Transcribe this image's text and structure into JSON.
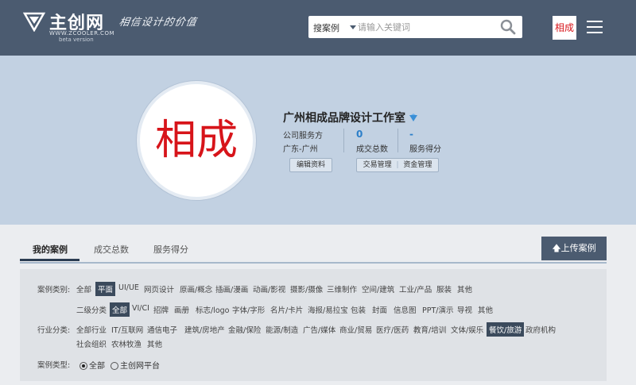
{
  "header": {
    "brand": "主创网",
    "url": "WWW.ZCOOLER.COM",
    "beta": "beta version",
    "slogan": "相信设计的价值",
    "search": {
      "type": "搜案例",
      "placeholder": "请输入关键词"
    },
    "avatar_text": "相成"
  },
  "profile": {
    "avatar_text": "相成",
    "name": "广州相成品牌设计工作室",
    "role": "公司服务方",
    "location": "广东-广州",
    "deals_value": "0",
    "deals_label": "成交总数",
    "score_value": "-",
    "score_label": "服务得分",
    "edit_label": "编辑资料",
    "trade_label": "交易管理",
    "fund_label": "资金管理"
  },
  "tabs": [
    "我的案例",
    "成交总数",
    "服务得分"
  ],
  "upload_label": "上传案例",
  "filters": {
    "category_label": "案例类别:",
    "categories": [
      "全部",
      "平面",
      "UI/UE",
      "网页设计",
      "原画/概念",
      "插画/漫画",
      "动画/影视",
      "摄影/摄像",
      "三维制作",
      "空间/建筑",
      "工业/产品",
      "服装",
      "其他"
    ],
    "sub_label": "二级分类",
    "subcategories": [
      "全部",
      "VI/CI",
      "招牌",
      "画册",
      "标志/logo",
      "字体/字形",
      "名片/卡片",
      "海报/易拉宝",
      "包装",
      "封面",
      "信息图",
      "PPT/演示",
      "导视",
      "其他"
    ],
    "industry_label": "行业分类:",
    "industries": [
      "全部行业",
      "IT/互联网",
      "通信电子",
      "建筑/房地产",
      "金融/保险",
      "能源/制造",
      "广告/媒体",
      "商业/贸易",
      "医疗/医药",
      "教育/培训",
      "文体/娱乐",
      "餐饮/旅游",
      "政府机构"
    ],
    "industries_row2": [
      "社会组织",
      "农林牧渔",
      "其他"
    ],
    "type_label": "案例类型:",
    "types": [
      "全部",
      "主创网平台"
    ]
  }
}
